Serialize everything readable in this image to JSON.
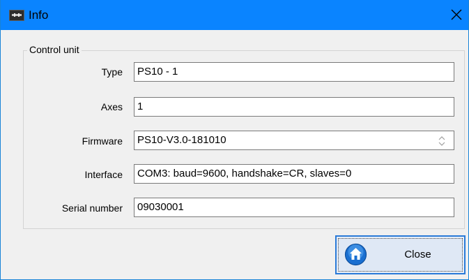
{
  "window": {
    "title": "Info",
    "close_glyph": "✕"
  },
  "group": {
    "legend": "Control unit"
  },
  "fields": {
    "type": {
      "label": "Type",
      "value": "PS10 - 1"
    },
    "axes": {
      "label": "Axes",
      "value": "1"
    },
    "firmware": {
      "label": "Firmware",
      "value": "PS10-V3.0-181010"
    },
    "interface": {
      "label": "Interface",
      "value": "COM3: baud=9600, handshake=CR, slaves=0"
    },
    "serial": {
      "label": "Serial number",
      "value": "09030001"
    }
  },
  "buttons": {
    "close_label": "Close"
  },
  "colors": {
    "titlebar": "#0a84ff",
    "button_border": "#2a7ad8",
    "icon_blue": "#1a6fd1"
  },
  "icons": {
    "title": "app-icon",
    "close": "close-icon",
    "button": "home-icon",
    "spinner": "spinner-icon"
  }
}
